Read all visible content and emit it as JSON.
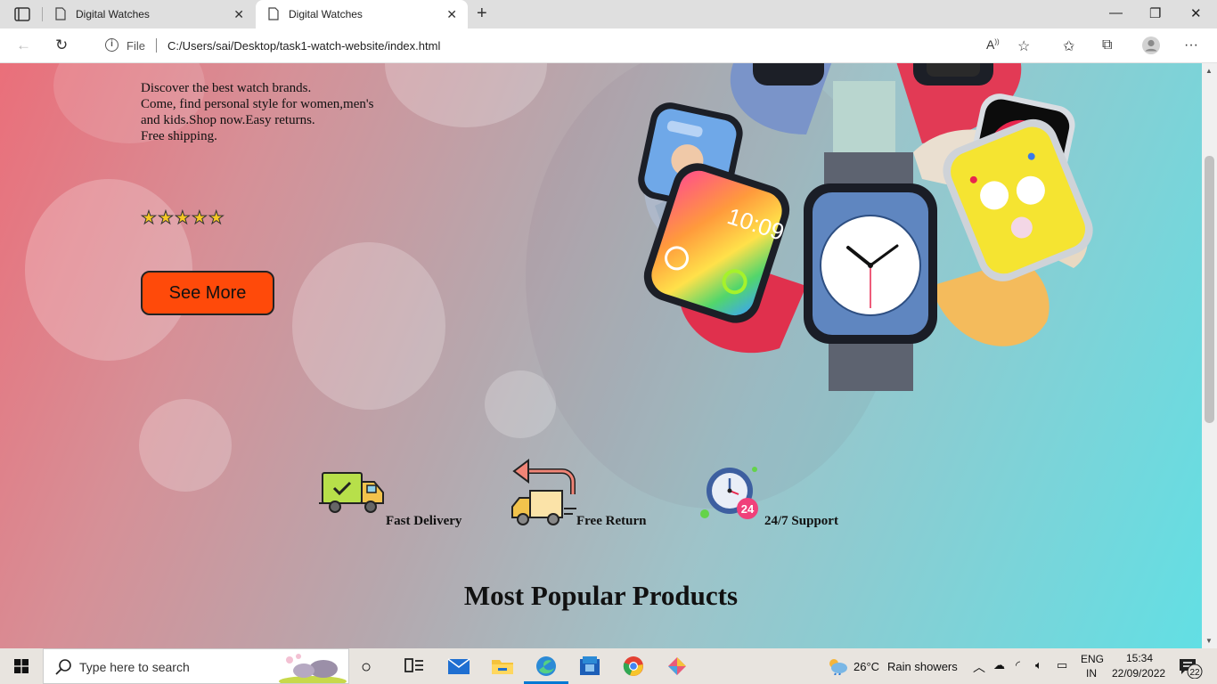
{
  "browser": {
    "tabs": [
      {
        "title": "Digital Watches",
        "active": false
      },
      {
        "title": "Digital Watches",
        "active": true
      }
    ],
    "address": {
      "scheme_label": "File",
      "url": "C:/Users/sai/Desktop/task1-watch-website/index.html"
    },
    "icons": [
      "tab-actions-icon",
      "page-icon",
      "close-icon",
      "plus-icon",
      "minimize-icon",
      "restore-icon",
      "window-close-icon",
      "back-icon",
      "reload-icon",
      "info-icon",
      "read-aloud-icon",
      "add-favorite-icon",
      "favorites-icon",
      "collections-icon",
      "profile-icon",
      "more-icon"
    ]
  },
  "page": {
    "hero": {
      "description": "Discover the best watch brands.\nCome, find personal style for women,men's\nand kids.Shop now.Easy returns.\nFree shipping.",
      "rating_stars": 5,
      "stars_text": "☆☆☆☆☆",
      "cta_label": "See More"
    },
    "features": [
      {
        "label": "Fast Delivery",
        "icon": "delivery-truck-icon"
      },
      {
        "label": "Free Return",
        "icon": "return-truck-icon"
      },
      {
        "label": "24/7 Support",
        "icon": "support-clock-icon",
        "badge": "24"
      }
    ],
    "section_title": "Most Popular Products",
    "watch_face_time": "10:09"
  },
  "taskbar": {
    "search_placeholder": "Type here to search",
    "weather": {
      "temp": "26°C",
      "condition": "Rain showers"
    },
    "language": {
      "lang": "ENG",
      "region": "IN"
    },
    "clock": {
      "time": "15:34",
      "date": "22/09/2022"
    },
    "notifications": "22",
    "apps": [
      "task-view-icon",
      "widgets-icon",
      "mail-icon",
      "file-explorer-icon",
      "edge-icon",
      "store-icon",
      "chrome-icon",
      "app-icon"
    ]
  },
  "colors": {
    "cta": "#ff4a0a",
    "star": "#f7c824",
    "taskbar_accent": "#0078d4"
  }
}
